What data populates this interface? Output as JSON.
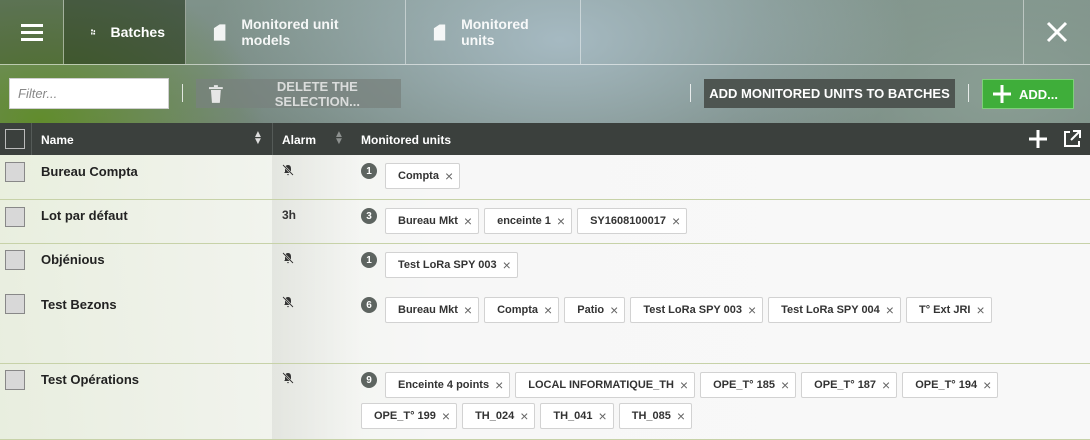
{
  "tabs": [
    {
      "label": "Batches",
      "icon": "batches-icon",
      "active": true
    },
    {
      "label": "Monitored unit models",
      "icon": "model-icon",
      "active": false
    },
    {
      "label": "Monitored units",
      "icon": "unit-icon",
      "active": false
    }
  ],
  "toolbar": {
    "filter_placeholder": "Filter...",
    "delete_label": "DELETE THE SELECTION...",
    "add_mu_label": "ADD MONITORED UNITS TO BATCHES",
    "add_label": "ADD..."
  },
  "table": {
    "headers": {
      "name": "Name",
      "alarm": "Alarm",
      "monitored_units": "Monitored units"
    },
    "rows": [
      {
        "name": "Bureau Compta",
        "alarm": "",
        "alarm_icon": "bell-off-icon",
        "count": "1",
        "units": [
          "Compta"
        ]
      },
      {
        "name": "Lot par défaut",
        "alarm": "3h",
        "alarm_icon": "",
        "count": "3",
        "units": [
          "Bureau Mkt",
          "enceinte 1",
          "SY1608100017"
        ]
      },
      {
        "name": "Objénious",
        "alarm": "",
        "alarm_icon": "bell-off-icon",
        "count": "1",
        "units": [
          "Test LoRa SPY 003"
        ]
      },
      {
        "name": "Test Bezons",
        "alarm": "",
        "alarm_icon": "bell-off-icon",
        "count": "6",
        "units": [
          "Bureau Mkt",
          "Compta",
          "Patio",
          "Test LoRa SPY 003",
          "Test LoRa SPY 004",
          "T° Ext JRI"
        ]
      },
      {
        "name": "Test Opérations",
        "alarm": "",
        "alarm_icon": "bell-off-icon",
        "count": "9",
        "units": [
          "Enceinte 4 points",
          "LOCAL INFORMATIQUE_TH",
          "OPE_T° 185",
          "OPE_T° 187",
          "OPE_T° 194",
          "OPE_T° 199",
          "TH_024",
          "TH_041",
          "TH_085"
        ]
      }
    ]
  },
  "colors": {
    "accent_green": "#3fae3a",
    "header_dark": "#3b403d"
  }
}
